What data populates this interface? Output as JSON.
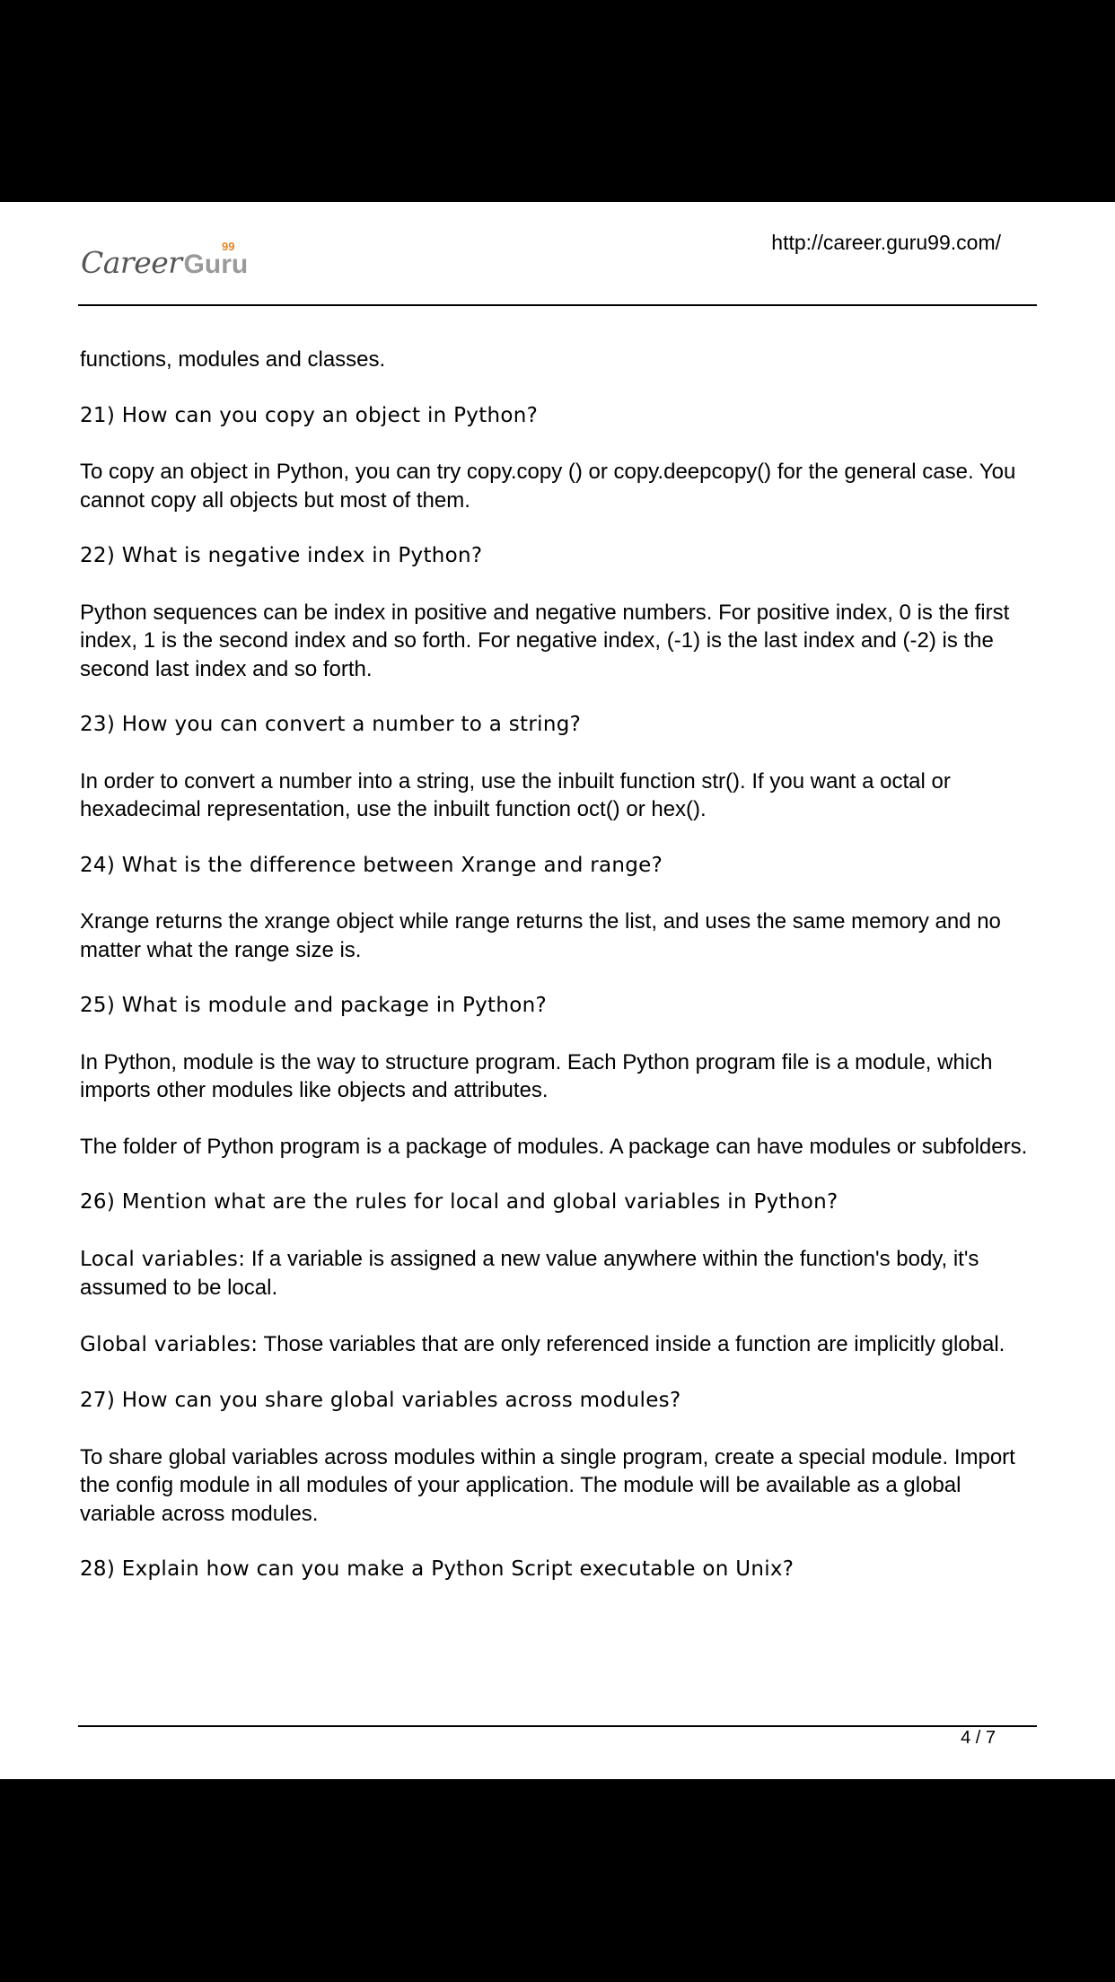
{
  "header": {
    "logo_text_career": "Career",
    "logo_text_guru": "Guru",
    "logo_superscript": "99",
    "url": "http://career.guru99.com/"
  },
  "paragraphs": [
    {
      "text": "functions, modules and classes."
    },
    {
      "text": "21)  How can you copy an object in Python?"
    },
    {
      "text": "To copy an object in Python, you can try copy.copy () or copy.deepcopy() for the general case. You cannot copy all objects but most of them."
    },
    {
      "text": "22) What is negative index in Python?"
    },
    {
      "text": "Python sequences can be index in positive and negative numbers.   For positive index, 0 is the first index, 1 is the second index and so forth.  For negative index, (-1) is the last index and (-2) is the second last index and so forth."
    },
    {
      "text": "23) How you can convert a number to a string?"
    },
    {
      "text": "In order to convert a number into a string, use the inbuilt function str().  If you want a octal or hexadecimal representation, use the inbuilt function oct() or hex()."
    },
    {
      "text": "24) What is the difference between Xrange and range?"
    },
    {
      "text": "Xrange returns the xrange object while range returns the list, and uses the same memory and no matter what the range size is."
    },
    {
      "text": "25) What is module and package in Python?"
    },
    {
      "text": "In Python, module is the way to structure program. Each Python program file is a module, which imports other modules like objects and attributes."
    },
    {
      "text": "The folder of Python program is a package of modules.  A package can have modules or subfolders."
    },
    {
      "text": "26) Mention what are the rules for local and global variables in Python?"
    },
    {
      "label": "Local variables:",
      "text": " If a variable is assigned a new value anywhere within the function's body, it's assumed to be local."
    },
    {
      "label": "Global variables:",
      "text": " Those variables that are only referenced inside a function are implicitly global."
    },
    {
      "text": "27) How can you share global variables across modules?"
    },
    {
      "text": "To share global variables across modules within a single program, create a special module. Import the config module in all modules of your application. The module will be available as a global variable across modules."
    },
    {
      "text": "28) Explain how can you make a Python Script executable on Unix?"
    }
  ],
  "footer": {
    "page_number": "4 / 7"
  }
}
